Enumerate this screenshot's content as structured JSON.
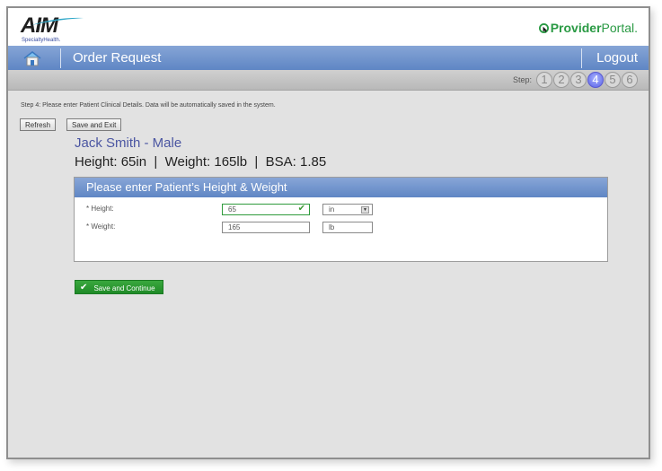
{
  "header": {
    "logo_main": "AIM",
    "logo_sub": "SpecialtyHealth.",
    "portal_bold": "Provider",
    "portal_thin": "Portal."
  },
  "nav": {
    "home_icon": "home-icon",
    "title": "Order Request",
    "logout": "Logout"
  },
  "steps": {
    "label": "Step:",
    "items": [
      "1",
      "2",
      "3",
      "4",
      "5",
      "6"
    ],
    "current": 4
  },
  "main": {
    "instruction": "Step 4: Please enter Patient Clinical Details. Data will be automatically saved in the system.",
    "refresh_label": "Refresh",
    "save_exit_label": "Save and Exit",
    "patient_name": "Jack Smith - Male",
    "patient_stats": "Height: 65in  |  Weight: 165lb  |  BSA: 1.85"
  },
  "panel": {
    "title": "Please enter Patient’s Height & Weight",
    "height_label": "* Height:",
    "height_value": "65",
    "height_unit": "in",
    "weight_label": "* Weight:",
    "weight_value": "165",
    "weight_unit": "lb"
  },
  "actions": {
    "save_continue": "Save and Continue"
  },
  "colors": {
    "nav_blue": "#5f86c4",
    "accent_green": "#2a9a44",
    "active_step": "#5961e6",
    "patient_name": "#4b56a2"
  }
}
